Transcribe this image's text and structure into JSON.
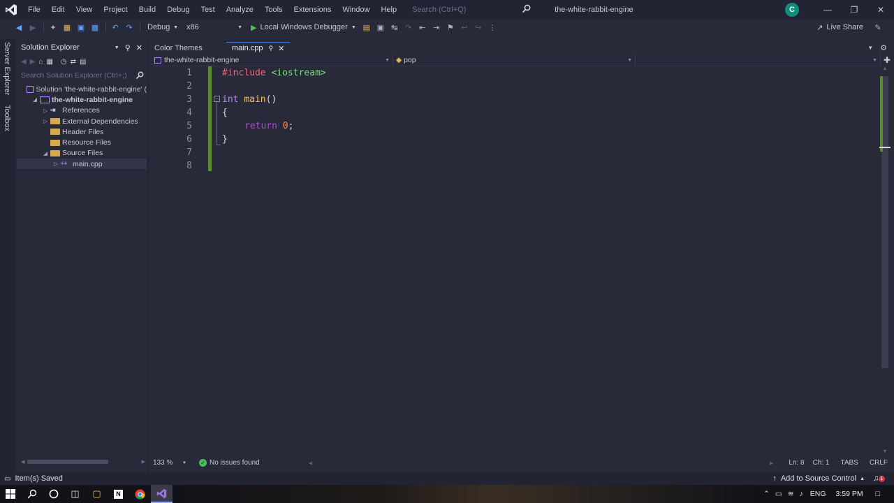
{
  "menubar": {
    "items": [
      "File",
      "Edit",
      "View",
      "Project",
      "Build",
      "Debug",
      "Test",
      "Analyze",
      "Tools",
      "Extensions",
      "Window",
      "Help"
    ],
    "search_placeholder": "Search (Ctrl+Q)",
    "window_title": "the-white-rabbit-engine",
    "avatar_letter": "C"
  },
  "toolbar": {
    "config": "Debug",
    "platform": "x86",
    "run_label": "Local Windows Debugger",
    "live_share": "Live Share"
  },
  "side_tabs": [
    "Server Explorer",
    "Toolbox"
  ],
  "solution_explorer": {
    "title": "Solution Explorer",
    "search_placeholder": "Search Solution Explorer (Ctrl+;)",
    "tree": [
      {
        "label": "Solution 'the-white-rabbit-engine' (",
        "indent": 0,
        "expander": "",
        "icon": "solution-icon"
      },
      {
        "label": "the-white-rabbit-engine",
        "indent": 1,
        "expander": "open",
        "icon": "project-icon",
        "bold": true
      },
      {
        "label": "References",
        "indent": 2,
        "expander": "closed",
        "icon": "references-icon"
      },
      {
        "label": "External Dependencies",
        "indent": 2,
        "expander": "closed",
        "icon": "folder-icon"
      },
      {
        "label": "Header Files",
        "indent": 2,
        "expander": "",
        "icon": "folder-icon"
      },
      {
        "label": "Resource Files",
        "indent": 2,
        "expander": "",
        "icon": "folder-icon"
      },
      {
        "label": "Source Files",
        "indent": 2,
        "expander": "open",
        "icon": "folder-icon"
      },
      {
        "label": "main.cpp",
        "indent": 3,
        "expander": "closed",
        "icon": "cpp-file-icon",
        "selected": true
      }
    ]
  },
  "editor": {
    "tabs": [
      {
        "label": "Color Themes",
        "active": false
      },
      {
        "label": "main.cpp",
        "active": true
      }
    ],
    "nav_project": "the-white-rabbit-engine",
    "nav_scope": "pop",
    "nav_member": "",
    "lines": [
      "1",
      "2",
      "3",
      "4",
      "5",
      "6",
      "7",
      "8"
    ],
    "code": {
      "l1_directive": "#include",
      "l1_header": "<iostream>",
      "l3_type": "int",
      "l3_fn": "main",
      "l3_paren": "()",
      "l4_brace": "{",
      "l5_return": "return",
      "l5_num": "0",
      "l5_semi": ";",
      "l6_brace": "}"
    },
    "zoom": "133 %",
    "issues": "No issues found",
    "ln": "Ln: 8",
    "ch": "Ch: 1",
    "tabs_mode": "TABS",
    "line_ending": "CRLF"
  },
  "statusbar": {
    "message": "Item(s) Saved",
    "source_control": "Add to Source Control"
  },
  "taskbar": {
    "lang": "ENG",
    "time": "3:59 PM",
    "notification_count": "1"
  },
  "colors": {
    "accent": "#3c7fd6",
    "preprocessor": "#ff5e7a",
    "include": "#77e07a",
    "type": "#b48cff",
    "function": "#f7c84b",
    "return": "#b04ad9",
    "number": "#ff8a4d",
    "change_bar": "#5a8a32"
  }
}
